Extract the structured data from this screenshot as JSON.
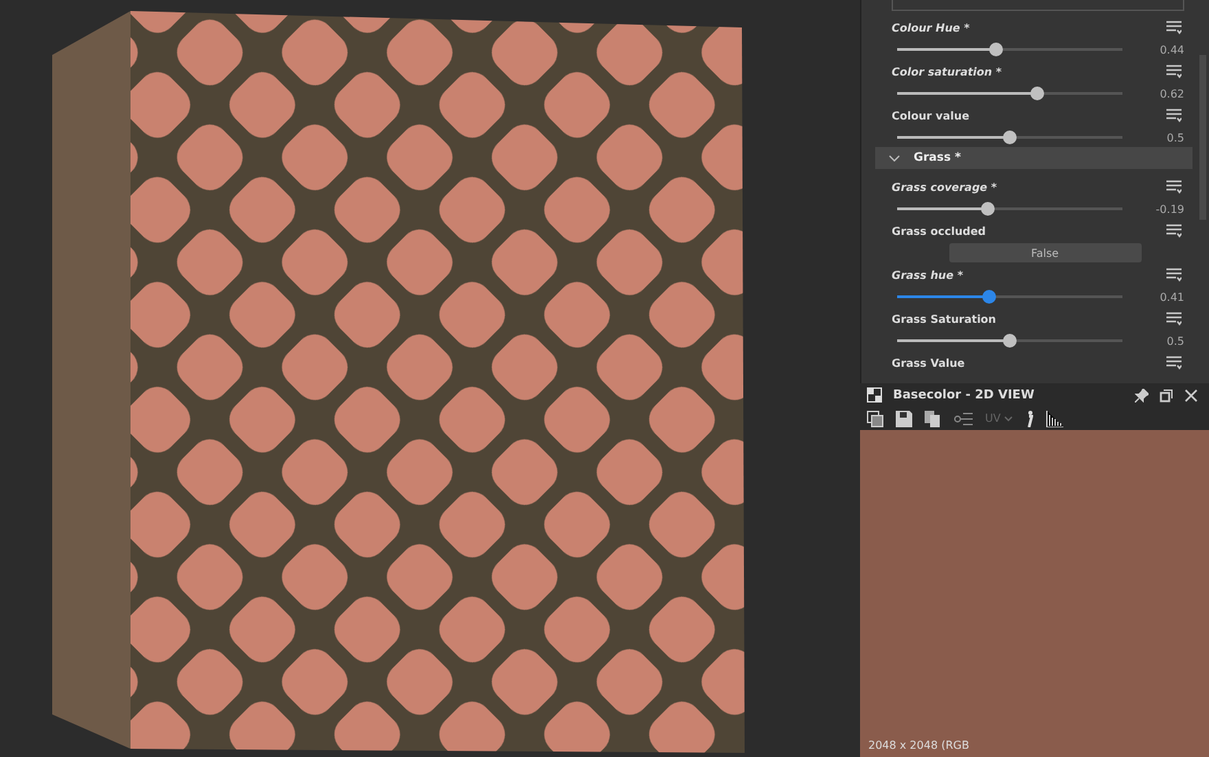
{
  "properties": [
    {
      "kind": "slider",
      "label": "Colour Hue *",
      "modified": true,
      "active": false,
      "level": 0.44,
      "reading": "0.44"
    },
    {
      "kind": "slider",
      "label": "Color saturation *",
      "modified": true,
      "active": false,
      "level": 0.62,
      "reading": "0.62"
    },
    {
      "kind": "slider",
      "label": "Colour value",
      "modified": false,
      "active": false,
      "level": 0.5,
      "reading": "0.5"
    },
    {
      "kind": "section",
      "label": "Grass *",
      "expanded": true
    },
    {
      "kind": "slider",
      "label": "Grass coverage *",
      "modified": true,
      "active": false,
      "level": 0.4,
      "reading": "-0.19"
    },
    {
      "kind": "toggle",
      "label": "Grass occluded",
      "modified": false,
      "value": "False"
    },
    {
      "kind": "slider",
      "label": "Grass hue *",
      "modified": true,
      "active": true,
      "level": 0.41,
      "reading": "0.41"
    },
    {
      "kind": "slider",
      "label": "Grass Saturation",
      "modified": false,
      "active": false,
      "level": 0.5,
      "reading": "0.5"
    },
    {
      "kind": "cut",
      "label": "Grass Value",
      "modified": false
    }
  ],
  "view2d": {
    "title": "Basecolor - 2D VIEW",
    "uv_label": "UV",
    "info": "2048 x 2048 (RGB"
  }
}
